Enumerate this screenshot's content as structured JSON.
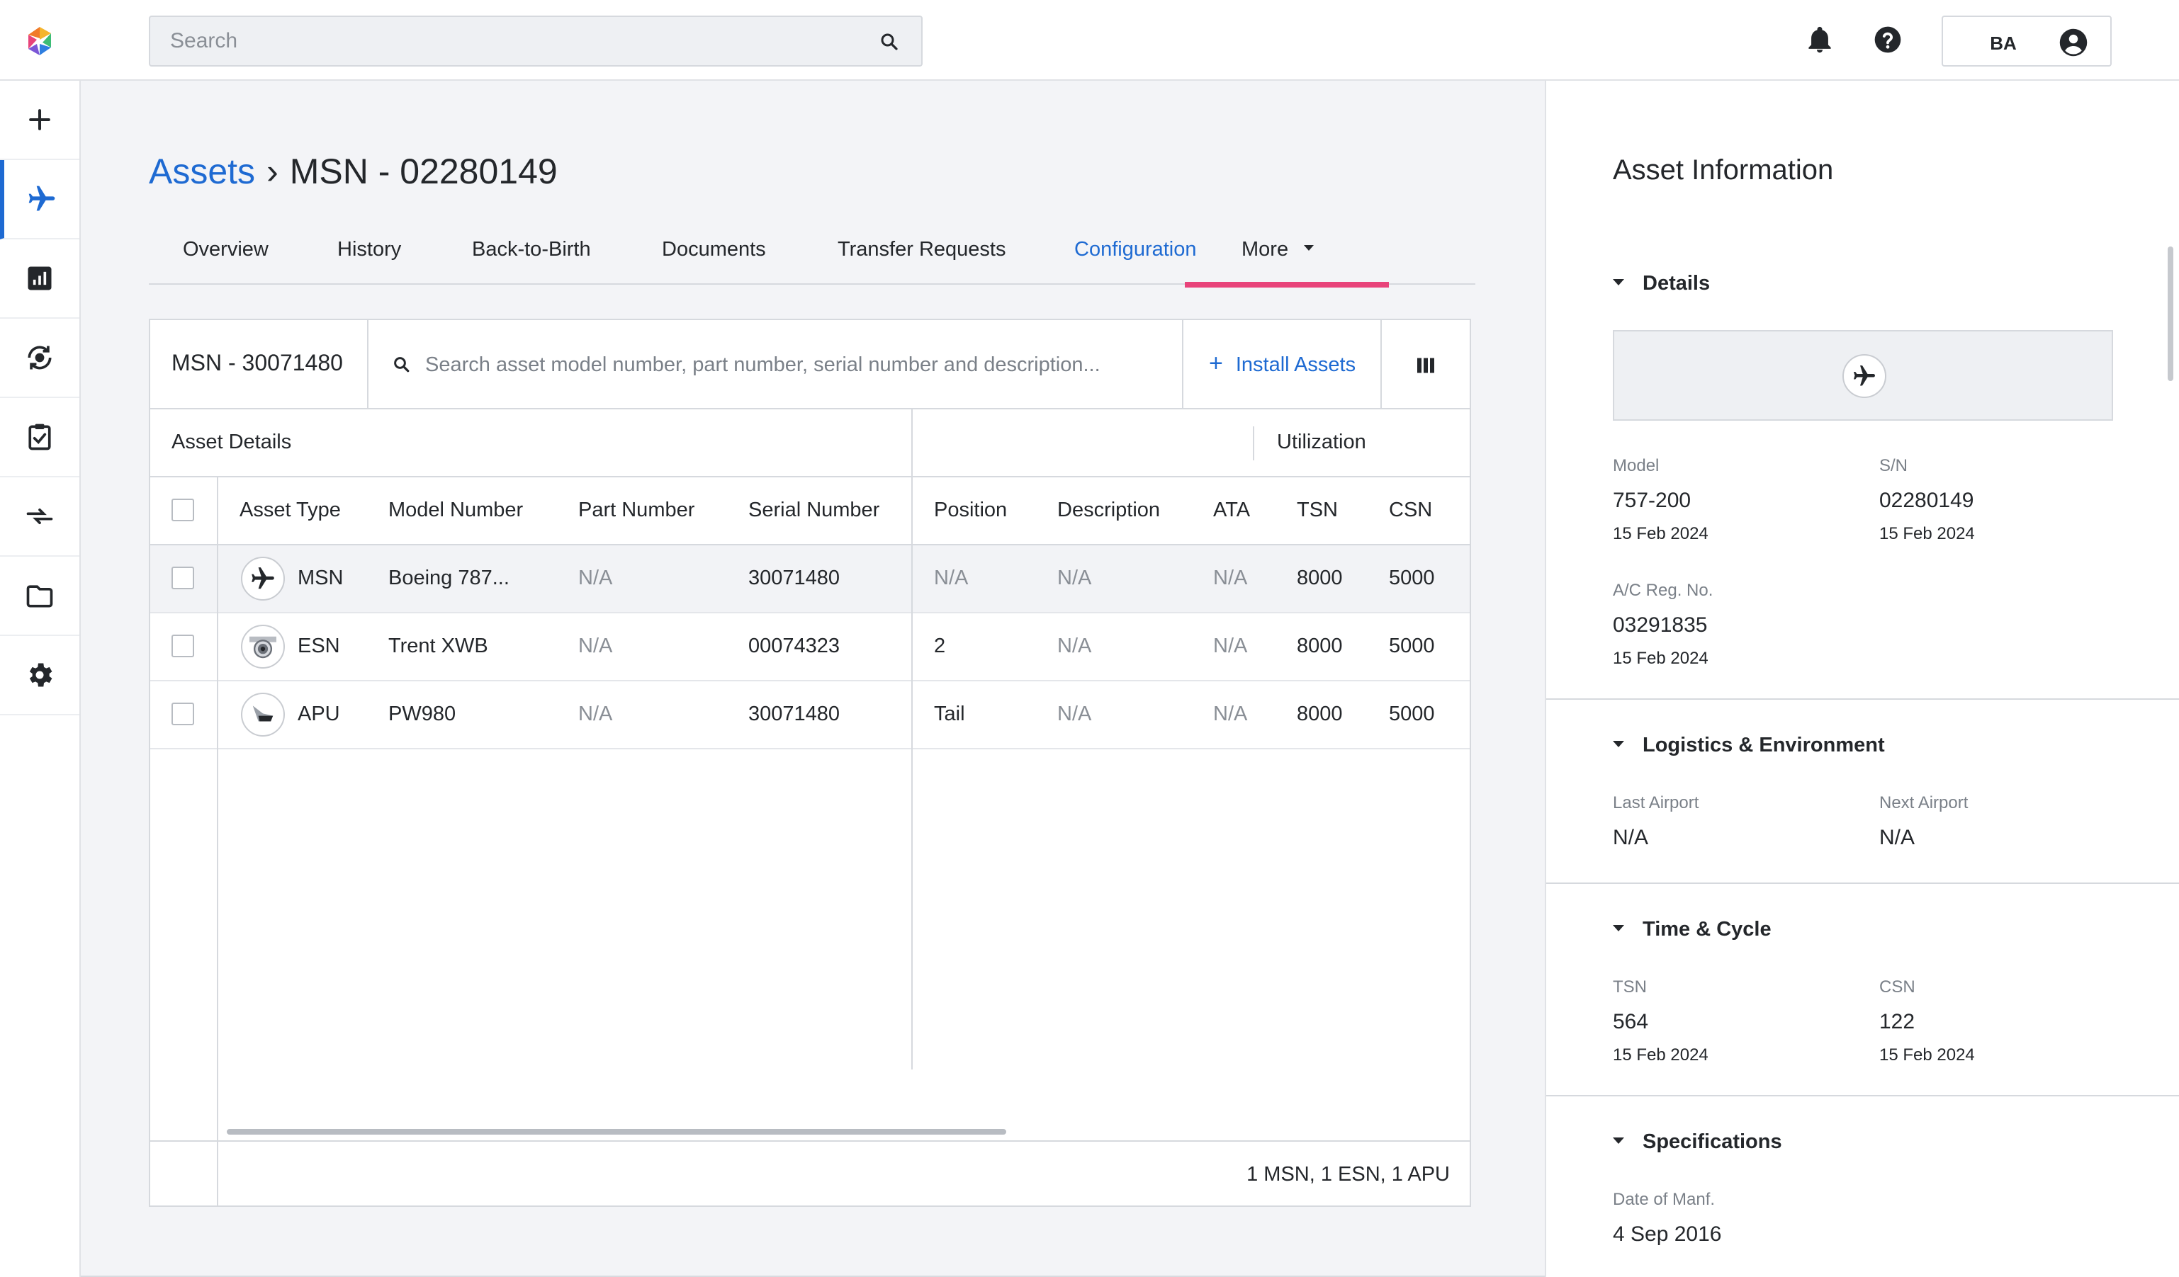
{
  "colors": {
    "accent": "#1e6ad2",
    "tab_indicator": "#e8437a"
  },
  "topbar": {
    "search_placeholder": "Search",
    "user_initials": "BA",
    "icons": [
      "logo-icon",
      "search-icon",
      "bell-icon",
      "help-icon",
      "account-icon"
    ]
  },
  "nav": {
    "items": [
      {
        "name": "add",
        "icon": "plus-icon"
      },
      {
        "name": "assets",
        "icon": "airplane-icon",
        "active": true
      },
      {
        "name": "reports",
        "icon": "bar-chart-icon"
      },
      {
        "name": "tracking",
        "icon": "sync-icon"
      },
      {
        "name": "tasks",
        "icon": "clipboard-check-icon"
      },
      {
        "name": "transfers",
        "icon": "transfer-arrows-icon"
      },
      {
        "name": "documents",
        "icon": "folder-icon"
      },
      {
        "name": "settings",
        "icon": "gear-icon"
      }
    ]
  },
  "breadcrumb": {
    "root": "Assets",
    "separator": "›",
    "current": "MSN - 02280149"
  },
  "tabs": [
    {
      "label": "Overview"
    },
    {
      "label": "History"
    },
    {
      "label": "Back-to-Birth"
    },
    {
      "label": "Documents"
    },
    {
      "label": "Transfer Requests"
    },
    {
      "label": "Configuration",
      "active": true
    },
    {
      "label": "More"
    }
  ],
  "table": {
    "asset_label": "MSN - 30071480",
    "search_placeholder": "Search asset model number, part number, serial number and description...",
    "install_label": "Install Assets",
    "group_asset_details": "Asset Details",
    "group_utilization": "Utilization",
    "columns": [
      "Asset Type",
      "Model Number",
      "Part Number",
      "Serial Number",
      "Position",
      "Description",
      "ATA",
      "TSN",
      "CSN"
    ],
    "rows": [
      {
        "type": "MSN",
        "icon": "airplane-icon",
        "model": "Boeing 787...",
        "part": "N/A",
        "serial": "30071480",
        "position": "N/A",
        "description": "N/A",
        "ata": "N/A",
        "tsn": "8000",
        "csn": "5000"
      },
      {
        "type": "ESN",
        "icon": "engine-icon",
        "model": "Trent XWB",
        "part": "N/A",
        "serial": "00074323",
        "position": "2",
        "description": "N/A",
        "ata": "N/A",
        "tsn": "8000",
        "csn": "5000"
      },
      {
        "type": "APU",
        "icon": "apu-tail-icon",
        "model": "PW980",
        "part": "N/A",
        "serial": "30071480",
        "position": "Tail",
        "description": "N/A",
        "ata": "N/A",
        "tsn": "8000",
        "csn": "5000"
      }
    ],
    "footer": "1 MSN, 1 ESN, 1 APU"
  },
  "panel": {
    "title": "Asset Information",
    "details": {
      "heading": "Details",
      "model_label": "Model",
      "model_value": "757-200",
      "model_date": "15 Feb 2024",
      "sn_label": "S/N",
      "sn_value": "02280149",
      "sn_date": "15 Feb 2024",
      "reg_label": "A/C Reg. No.",
      "reg_value": "03291835",
      "reg_date": "15 Feb 2024"
    },
    "logistics": {
      "heading": "Logistics & Environment",
      "last_label": "Last Airport",
      "last_value": "N/A",
      "next_label": "Next Airport",
      "next_value": "N/A"
    },
    "time_cycle": {
      "heading": "Time & Cycle",
      "tsn_label": "TSN",
      "tsn_value": "564",
      "tsn_date": "15 Feb 2024",
      "csn_label": "CSN",
      "csn_value": "122",
      "csn_date": "15 Feb 2024"
    },
    "specs": {
      "heading": "Specifications",
      "manf_label": "Date of Manf.",
      "manf_value": "4 Sep 2016"
    }
  }
}
